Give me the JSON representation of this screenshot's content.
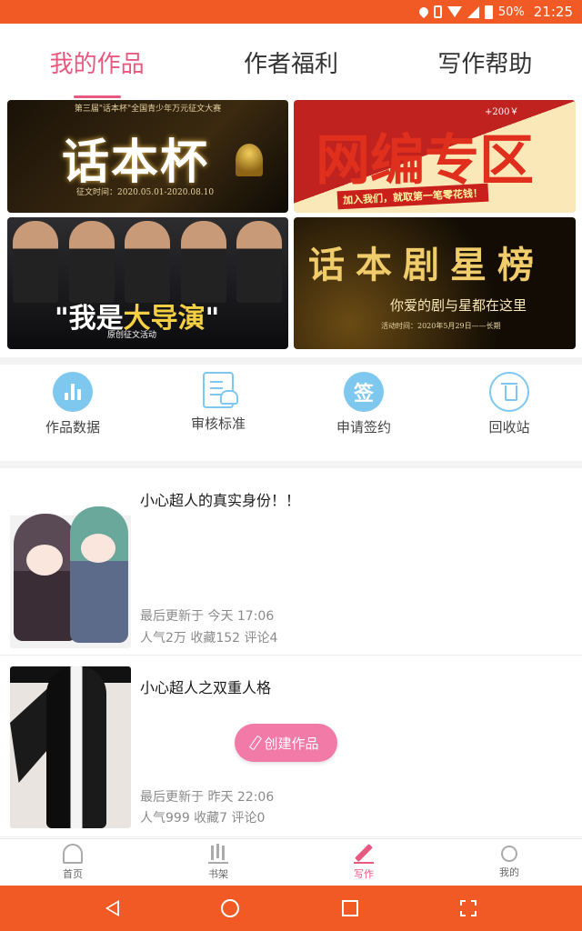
{
  "status_bar": {
    "battery_pct": "50%",
    "time": "21:25"
  },
  "top_tabs": [
    {
      "label": "我的作品",
      "active": true
    },
    {
      "label": "作者福利",
      "active": false
    },
    {
      "label": "写作帮助",
      "active": false
    }
  ],
  "banners": {
    "b1": {
      "top_text": "第三届\"话本杯\"全国青少年万元征文大赛",
      "title": "话本杯",
      "date": "征文时间：2020.05.01-2020.08.10"
    },
    "b2": {
      "title": "网编专区",
      "tag": "+200￥",
      "slogan": "加入我们，就取第一笔零花钱！"
    },
    "b3": {
      "title_prefix": "\"我是",
      "title_main": "大导演",
      "title_suffix": "\"",
      "subtitle": "原创征文活动"
    },
    "b4": {
      "title": "话本剧星榜",
      "subtitle": "你爱的剧与星都在这里",
      "small": "活动时间：2020年5月29日——长期"
    }
  },
  "shortcuts": [
    {
      "label": "作品数据",
      "icon": "bar-chart-icon"
    },
    {
      "label": "审核标准",
      "icon": "review-doc-icon"
    },
    {
      "label": "申请签约",
      "icon": "sign-icon",
      "glyph": "签"
    },
    {
      "label": "回收站",
      "icon": "trash-icon"
    }
  ],
  "works": [
    {
      "title": "小心超人的真实身份！！",
      "updated": "最后更新于 今天 17:06",
      "stats": "人气2万 收藏152 评论4"
    },
    {
      "title": "小心超人之双重人格",
      "updated": "最后更新于 昨天 22:06",
      "stats": "人气999 收藏7 评论0"
    }
  ],
  "create_button": {
    "label": "创建作品"
  },
  "bottom_nav": [
    {
      "label": "首页",
      "icon": "home-icon"
    },
    {
      "label": "书架",
      "icon": "bookshelf-icon"
    },
    {
      "label": "写作",
      "icon": "write-icon",
      "active": true
    },
    {
      "label": "我的",
      "icon": "profile-icon"
    }
  ],
  "colors": {
    "accent": "#e8597f",
    "system_bar": "#f15a24",
    "icon_blue": "#7ec8f0"
  }
}
